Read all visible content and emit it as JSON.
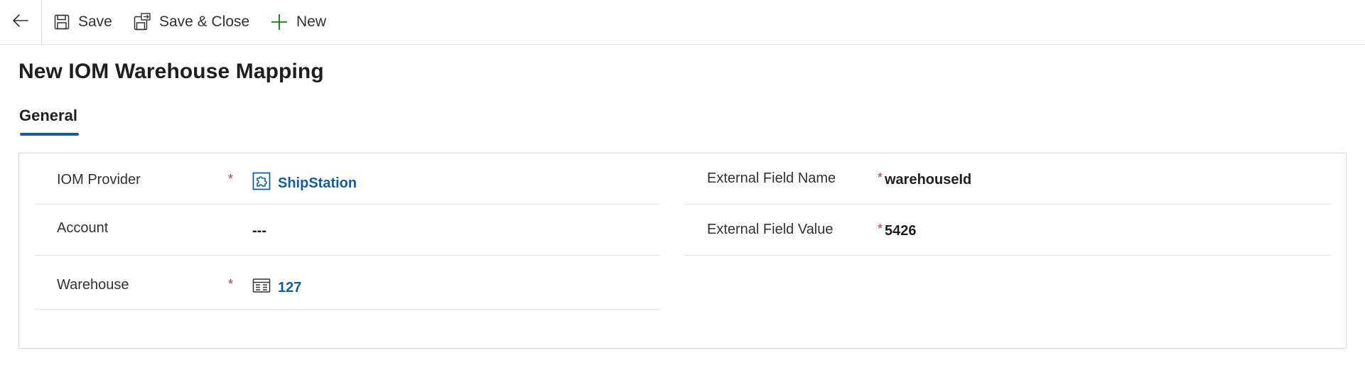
{
  "toolbar": {
    "back_icon": "arrow-left-icon",
    "save_label": "Save",
    "save_icon": "floppy-disk-icon",
    "save_close_label": "Save & Close",
    "save_close_icon": "save-close-icon",
    "new_label": "New",
    "new_icon": "plus-icon"
  },
  "page": {
    "title": "New IOM Warehouse Mapping"
  },
  "tabs": [
    {
      "label": "General",
      "selected": true
    }
  ],
  "form": {
    "left": [
      {
        "label": "IOM Provider",
        "required": "*",
        "value": "ShipStation",
        "type": "lookup",
        "icon": "puzzle-icon"
      },
      {
        "label": "Account",
        "required": "",
        "value": "---",
        "type": "text"
      },
      {
        "label": "Warehouse",
        "required": "*",
        "value": "127",
        "type": "lookup",
        "icon": "warehouse-icon"
      }
    ],
    "right": [
      {
        "label": "External Field Name",
        "required": "*",
        "value": "warehouseId",
        "type": "text"
      },
      {
        "label": "External Field Value",
        "required": "*",
        "value": "5426",
        "type": "text"
      }
    ]
  },
  "colors": {
    "link": "#115ea3",
    "required": "#c4314b",
    "tab_underline": "#115ea3",
    "add_icon": "#107c10"
  }
}
